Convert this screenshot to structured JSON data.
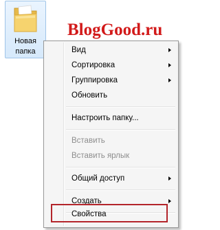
{
  "desktop": {
    "folder": {
      "icon": "folder-icon",
      "label_line1": "Новая",
      "label_line2": "папка"
    },
    "watermark": "BlogGood.ru"
  },
  "context_menu": {
    "items": [
      {
        "label": "Вид",
        "submenu": true,
        "enabled": true
      },
      {
        "label": "Сортировка",
        "submenu": true,
        "enabled": true
      },
      {
        "label": "Группировка",
        "submenu": true,
        "enabled": true
      },
      {
        "label": "Обновить",
        "submenu": false,
        "enabled": true
      },
      {
        "label": "Настроить папку...",
        "submenu": false,
        "enabled": true
      },
      {
        "label": "Вставить",
        "submenu": false,
        "enabled": false
      },
      {
        "label": "Вставить ярлык",
        "submenu": false,
        "enabled": false
      },
      {
        "label": "Общий доступ",
        "submenu": true,
        "enabled": true
      },
      {
        "label": "Создать",
        "submenu": true,
        "enabled": true
      },
      {
        "label": "Свойства",
        "submenu": false,
        "enabled": true
      }
    ],
    "highlighted_item": "Свойства"
  },
  "colors": {
    "watermark": "#d21a1a",
    "highlight_box": "#b3242a",
    "menu_background": "#f5f5f5",
    "disabled_text": "#8d8d8d"
  }
}
